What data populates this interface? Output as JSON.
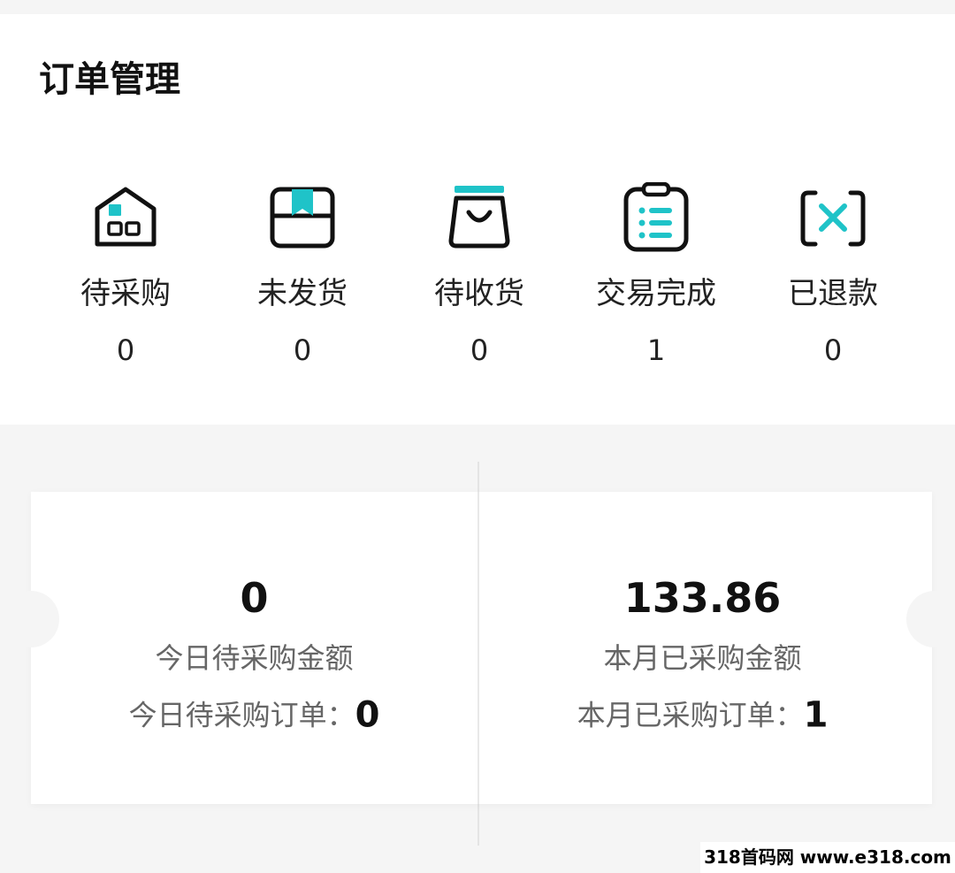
{
  "order_management": {
    "title": "订单管理",
    "statuses": [
      {
        "icon": "house-icon",
        "label": "待采购",
        "count": "0"
      },
      {
        "icon": "package-icon",
        "label": "未发货",
        "count": "0"
      },
      {
        "icon": "shopping-bag-icon",
        "label": "待收货",
        "count": "0"
      },
      {
        "icon": "clipboard-list-icon",
        "label": "交易完成",
        "count": "1"
      },
      {
        "icon": "refund-x-icon",
        "label": "已退款",
        "count": "0"
      }
    ]
  },
  "stats": {
    "today": {
      "amount": "0",
      "amount_label": "今日待采购金额",
      "orders_label": "今日待采购订单：",
      "orders_count": "0"
    },
    "month": {
      "amount": "133.86",
      "amount_label": "本月已采购金额",
      "orders_label": "本月已采购订单：",
      "orders_count": "1"
    }
  },
  "watermark": "318首码网 www.e318.com",
  "colors": {
    "accent": "#1fc3c8",
    "icon_stroke": "#111111",
    "background": "#f5f5f5",
    "card": "#ffffff",
    "muted_text": "#666666"
  }
}
